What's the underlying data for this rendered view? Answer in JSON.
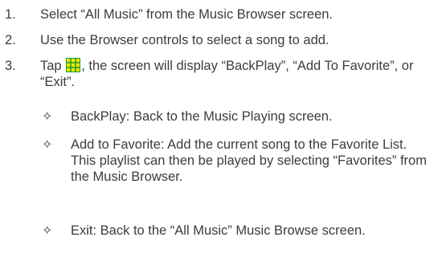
{
  "steps": [
    {
      "number": "1.",
      "text": "Select “All Music” from the Music Browser screen."
    },
    {
      "number": "2.",
      "text": "Use the Browser controls to select a song to add."
    },
    {
      "number": "3.",
      "text_before_icon": "Tap",
      "icon": "grid-menu-icon",
      "text_after_icon": ", the screen will display “BackPlay”, “Add To Favorite”, or “Exit”."
    }
  ],
  "options": [
    {
      "bullet": "✧",
      "text": "BackPlay: Back to the Music Playing screen."
    },
    {
      "bullet": "✧",
      "text": "Add to Favorite: Add the current song to the Favorite List. This playlist can then be played by selecting “Favorites” from the Music Browser."
    },
    {
      "bullet": "✧",
      "text": "Exit: Back to the “All Music” Music Browse screen."
    }
  ],
  "colors": {
    "text": "#3c3c3c",
    "icon_fill": "#f2e600",
    "icon_grid": "#1f9a2e"
  }
}
